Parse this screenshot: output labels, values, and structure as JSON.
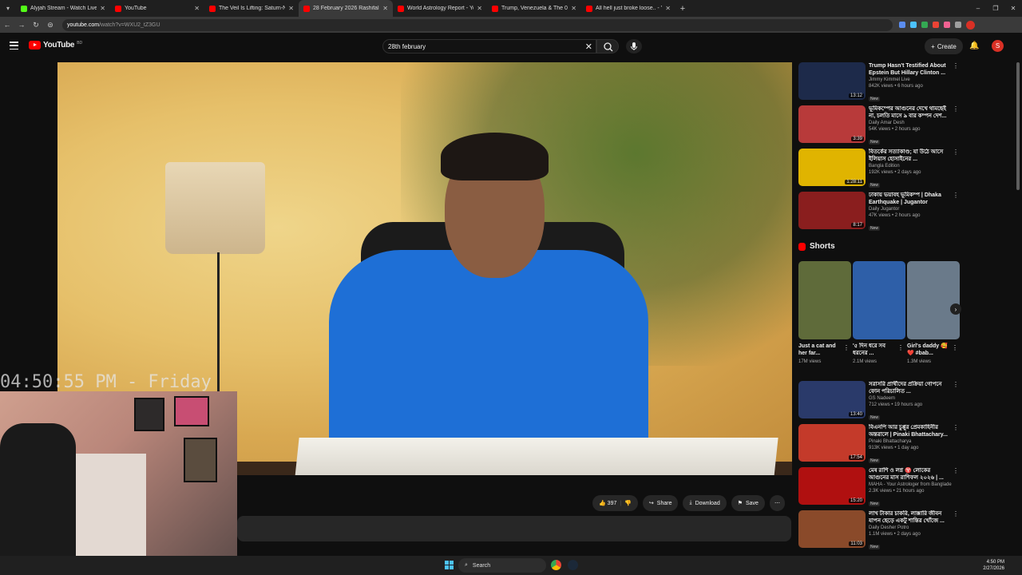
{
  "browser": {
    "tabs": [
      {
        "title": "Alyjah Stream - Watch Live on",
        "color": "#53fc18",
        "active": false
      },
      {
        "title": "YouTube",
        "color": "#ff0000",
        "active": false
      },
      {
        "title": "The Veil Is Lifting: Saturn-Nept",
        "color": "#ff0000",
        "active": false
      },
      {
        "title": "28 February 2026 Rashifal",
        "color": "#ff0000",
        "active": true
      },
      {
        "title": "World Astrology Report - YouTu",
        "color": "#ff0000",
        "active": false
      },
      {
        "title": "Trump, Venezuela & The 0° Ari",
        "color": "#ff0000",
        "active": false
      },
      {
        "title": "All hell just broke loose.. - YouT",
        "color": "#ff0000",
        "active": false
      }
    ],
    "new_tab": "+",
    "url_domain": "youtube.com",
    "url_path": "/watch?v=WXU2_tZ3GU"
  },
  "masthead": {
    "logo_text": "YouTube",
    "country_code": "BD",
    "search_value": "28th february",
    "create_label": "Create",
    "avatar_letter": "S"
  },
  "player": {
    "clock_overlay": "04:50:55 PM - Friday"
  },
  "actions": {
    "likes": "397",
    "share": "Share",
    "download": "Download",
    "save": "Save"
  },
  "sidebar": {
    "videos": [
      {
        "title": "Trump Hasn't Testified About Epstein But Hillary Clinton ...",
        "channel": "Jimmy Kimmel Live",
        "stats": "842K views • 6 hours ago",
        "badge": "New",
        "duration": "13:12",
        "thumb": "#1d2a4a"
      },
      {
        "title": "ভূমিকম্পের আগুনের দেখে থামছেই না, চলতি মাসে ৯ বার কম্পন দেশ...",
        "channel": "Daily Amar Desh",
        "stats": "54K views • 2 hours ago",
        "badge": "New",
        "duration": "3:39",
        "thumb": "#b83a3a"
      },
      {
        "title": "বিতর্কের সত্যাকাণ্ড; যা উঠে আসে ইলিয়াস হোসাইনের ...",
        "channel": "Bangla Edition",
        "stats": "192K views • 2 days ago",
        "badge": "New",
        "duration": "1:28:11",
        "thumb": "#e0b400"
      },
      {
        "title": "ঢাকায় ভয়াবহ ভূমিকম্প | Dhaka Earthquake | Jugantor",
        "channel": "Daily Jugantor",
        "stats": "47K views • 2 hours ago",
        "badge": "New",
        "duration": "8:17",
        "thumb": "#8a1e1e"
      }
    ],
    "shorts_title": "Shorts",
    "shorts": [
      {
        "title": "Just a cat and her far...",
        "views": "17M views",
        "thumb": "#5f6b3a"
      },
      {
        "title": "'৫ দিন ধরে সব ধরনের ...",
        "views": "2.1M views",
        "thumb": "#2e5fa8"
      },
      {
        "title": "Girl's daddy 🥰❤️ #bab...",
        "views": "1.3M views",
        "thumb": "#6a7a8a"
      }
    ],
    "videos2": [
      {
        "title": "সরাসরি প্রার্থীদের প্রক্রিয়া গোপনে ফোন পরিচালিত ...",
        "channel": "GS Nadeem",
        "stats": "712 views • 19 hours ago",
        "badge": "New",
        "duration": "13:40",
        "thumb": "#2a3a6a"
      },
      {
        "title": "বিএনপি আর চুপ্পুর প্রেমকাহিনীর অন্তরালে | Pinaki Bhattachary...",
        "channel": "Pinaki Bhattacharya",
        "stats": "913K views • 1 day ago",
        "badge": "New",
        "duration": "17:54",
        "thumb": "#c43a2a"
      },
      {
        "title": "মেষ রাশি ও লগ্ন ♈ লোকের আগুনের মাস রাশিফল ২০২৬ | ...",
        "channel": "MAHA - Your Astrologer from Bangladesh",
        "stats": "2.3K views • 21 hours ago",
        "badge": "New",
        "duration": "15:20",
        "thumb": "#b01010"
      },
      {
        "title": "লাখ টাকার চাকরি, লাক্সারি জীবন যাপন ছেড়ে একটু শান্তির খোঁজে ...",
        "channel": "Daily Desher Potro",
        "stats": "1.1M views • 2 days ago",
        "badge": "New",
        "duration": "11:03",
        "thumb": "#8a4a2a"
      }
    ]
  },
  "taskbar": {
    "search_label": "Search",
    "time": "4:50 PM",
    "date": "2/27/2026"
  }
}
